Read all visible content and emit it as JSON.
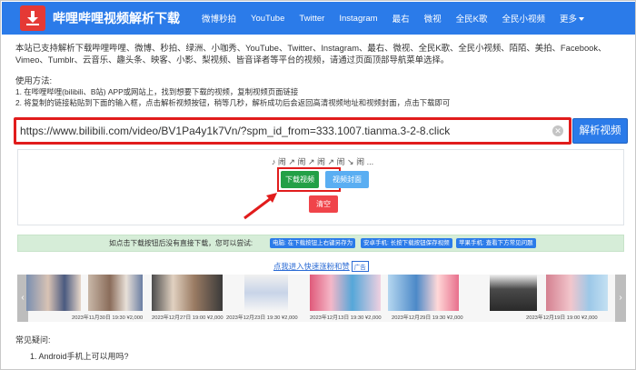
{
  "navbar": {
    "brand": "哔哩哔哩视频解析下载",
    "items": [
      "微博秒拍",
      "YouTube",
      "Twitter",
      "Instagram",
      "最右",
      "微视",
      "全民K歌",
      "全民小视频",
      "更多"
    ],
    "accent": "#2b7be9"
  },
  "intro": {
    "text": "本站已支持解析下载哔哩哔哩、微博、秒拍、绿洲、小咖秀、YouTube、Twitter、Instagram、最右、微视、全民K歌、全民小视频、陌陌、美拍、Facebook、Vimeo、Tumblr、云音乐、趣头条、映客、小影、梨视频、皆音译者等平台的视频，请通过页面顶部导航菜单选择。",
    "usage_title": "使用方法:",
    "steps": [
      "1. 在哔哩哔哩(bilibili、B站) APP或网站上，找到想要下载的视频，复制视频页面链接",
      "2. 将复制的链接粘贴到下面的输入框，点击解析视频按钮，稍等几秒，解析成功后会返回高清视频地址和视频封面，点击下载即可"
    ]
  },
  "search": {
    "value": "https://www.bilibili.com/video/BV1Pa4y1k7Vn/?spm_id_from=333.1007.tianma.3-2-8.click",
    "parse_label": "解析视频"
  },
  "result": {
    "music": "♪ 闹 ↗ 闹 ↗ 闹 ↗ 闹 ↘ 闹 ...",
    "download_label": "下载视频",
    "cover_label": "视频封面",
    "clear_label": "清空"
  },
  "tip": {
    "text": "如点击下载按钮后没有直接下载，您可以尝试:",
    "badges": [
      "电脑: 在下载按钮上右键另存为",
      "安卓手机: 长按下载按钮保存视频",
      "苹果手机: 查看下方常见问题"
    ]
  },
  "forward": {
    "link": "点我进入快速涨粉和赞",
    "ad": "广告"
  },
  "carousel": {
    "dates": [
      "2023年11月30日 19:30 ¥2,000",
      "2023年12月27日 19:00 ¥2,000",
      "2023年12月23日 19:30 ¥2,000",
      "2023年12月13日 19:30 ¥2,000",
      "2023年12月29日 19:30 ¥2,000",
      "2023年12月19日 19:00 ¥2,000"
    ]
  },
  "faq": {
    "title": "常见疑问:",
    "items": [
      "1. Android手机上可以用吗?"
    ]
  }
}
